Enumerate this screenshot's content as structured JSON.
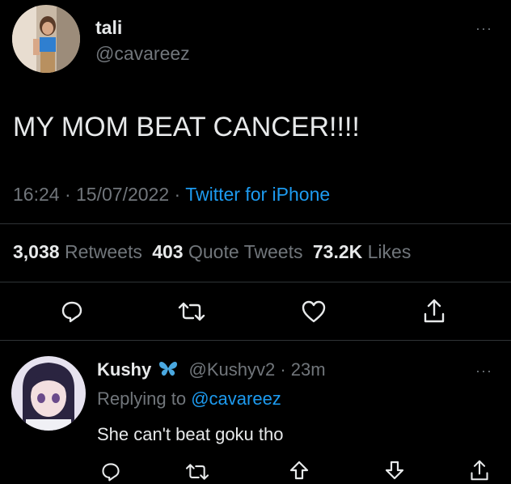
{
  "tweet": {
    "author_name": "tali",
    "author_handle": "@cavareez",
    "text": "MY MOM BEAT CANCER!!!!",
    "time": "16:24",
    "separator": "·",
    "date": "15/07/2022",
    "source": "Twitter for iPhone",
    "stats": {
      "retweets_count": "3,038",
      "retweets_label": "Retweets",
      "quotes_count": "403",
      "quotes_label": "Quote Tweets",
      "likes_count": "73.2K",
      "likes_label": "Likes"
    },
    "more": "···"
  },
  "reply": {
    "author_name": "Kushy",
    "author_handle": "@Kushyv2",
    "separator": "·",
    "age": "23m",
    "replying_prefix": "Replying to",
    "replying_handle": "@cavareez",
    "text": "She can't beat goku tho",
    "more": "···"
  },
  "icons": {
    "reply": "reply-icon",
    "retweet": "retweet-icon",
    "like": "heart-icon",
    "share": "share-icon",
    "badge": "butterfly-icon",
    "upvote": "arrow-up-icon",
    "downvote": "arrow-down-icon"
  },
  "colors": {
    "background": "#000000",
    "text": "#e7e9ea",
    "secondary": "#71767b",
    "link": "#1d9bf0",
    "badge": "#4aa8e0"
  }
}
